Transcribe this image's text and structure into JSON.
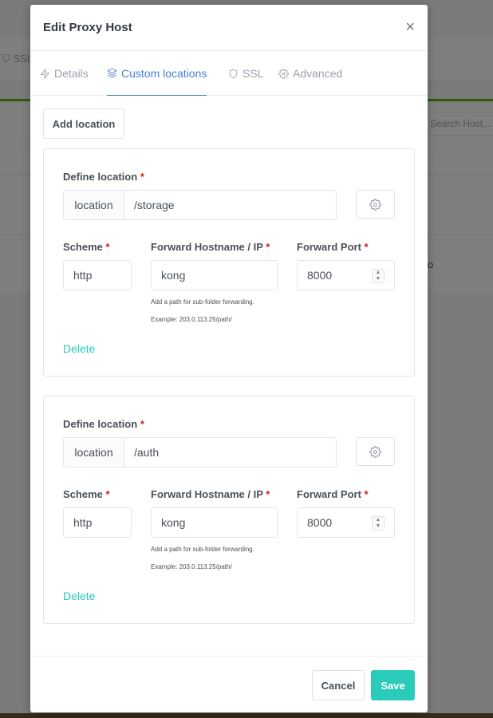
{
  "background": {
    "tab_ssl": "SSL",
    "search_placeholder": "Search Host...",
    "partial_text": "o"
  },
  "modal": {
    "title": "Edit Proxy Host",
    "close_glyph": "×",
    "tabs": [
      {
        "label": "Details",
        "icon": "lightning-icon",
        "active": false
      },
      {
        "label": "Custom locations",
        "icon": "layers-icon",
        "active": true
      },
      {
        "label": "SSL",
        "icon": "shield-icon",
        "active": false
      },
      {
        "label": "Advanced",
        "icon": "gear-icon",
        "active": false
      }
    ],
    "add_location_label": "Add location",
    "locations": [
      {
        "define_label": "Define location",
        "prefix": "location",
        "path": "/storage",
        "scheme_label": "Scheme",
        "scheme": "http",
        "host_label": "Forward Hostname / IP",
        "host": "kong",
        "port_label": "Forward Port",
        "port": "8000",
        "help_line1": "Add a path for sub-folder forwarding.",
        "help_line2": "Example: 203.0.113.25/path/",
        "delete_label": "Delete",
        "required_mark": "*"
      },
      {
        "define_label": "Define location",
        "prefix": "location",
        "path": "/auth",
        "scheme_label": "Scheme",
        "scheme": "http",
        "host_label": "Forward Hostname / IP",
        "host": "kong",
        "port_label": "Forward Port",
        "port": "8000",
        "help_line1": "Add a path for sub-folder forwarding.",
        "help_line2": "Example: 203.0.113.25/path/",
        "delete_label": "Delete",
        "required_mark": "*"
      }
    ],
    "cancel_label": "Cancel",
    "save_label": "Save"
  },
  "colors": {
    "accent_teal": "#2bcbba",
    "tab_active": "#467fcf",
    "required": "#cd201f",
    "green_bar": "#5eba00"
  }
}
